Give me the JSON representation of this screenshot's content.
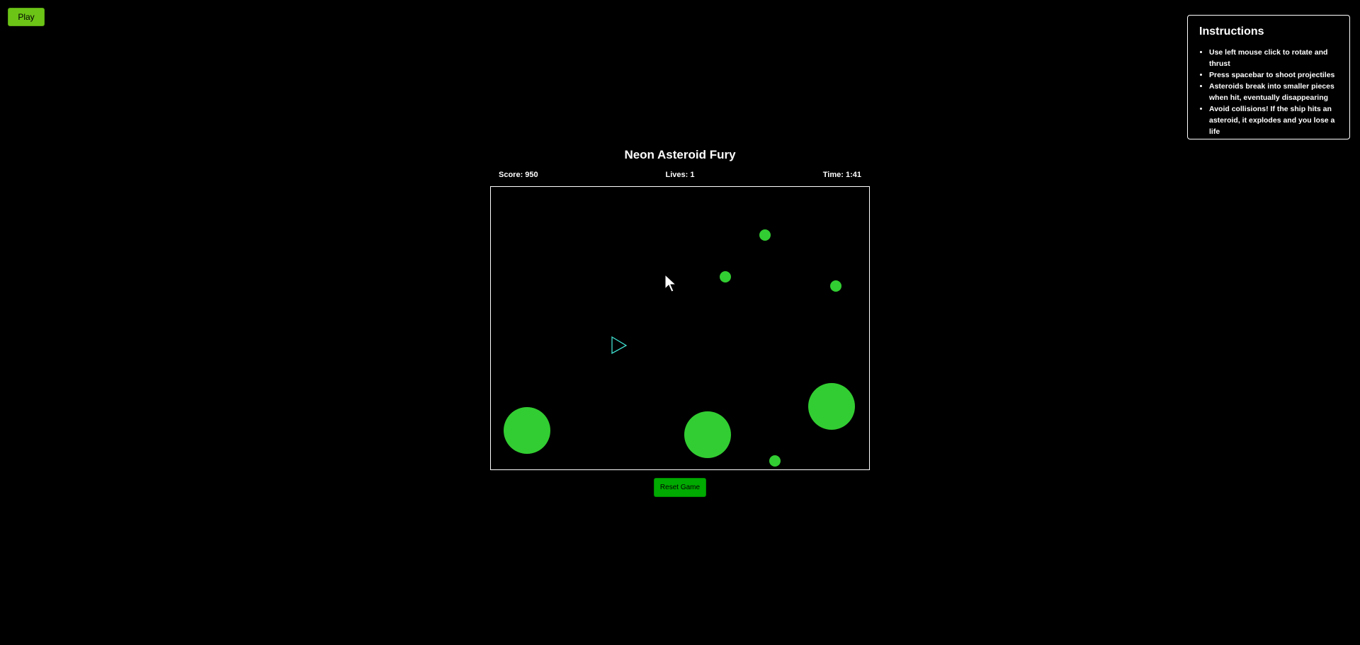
{
  "toolbar": {
    "play_label": "Play"
  },
  "instructions": {
    "title": "Instructions",
    "items": [
      "Use left mouse click to rotate and thrust",
      "Press spacebar to shoot projectiles",
      "Asteroids break into smaller pieces when hit, eventually disappearing",
      "Avoid collisions! If the ship hits an asteroid, it explodes and you lose a life"
    ]
  },
  "game": {
    "title": "Neon Asteroid Fury",
    "score_text": "Score: 950",
    "lives_text": "Lives: 1",
    "time_text": "Time: 1:41",
    "reset_label": "Reset Game"
  },
  "colors": {
    "background": "#000000",
    "asteroid": "#32cd32",
    "ship": "#40e0d0",
    "play_button": "#6cc417",
    "reset_button": "#00aa00",
    "border": "#ffffff"
  },
  "icons": {
    "ship": "ship-icon",
    "cursor": "mouse-cursor-icon"
  }
}
